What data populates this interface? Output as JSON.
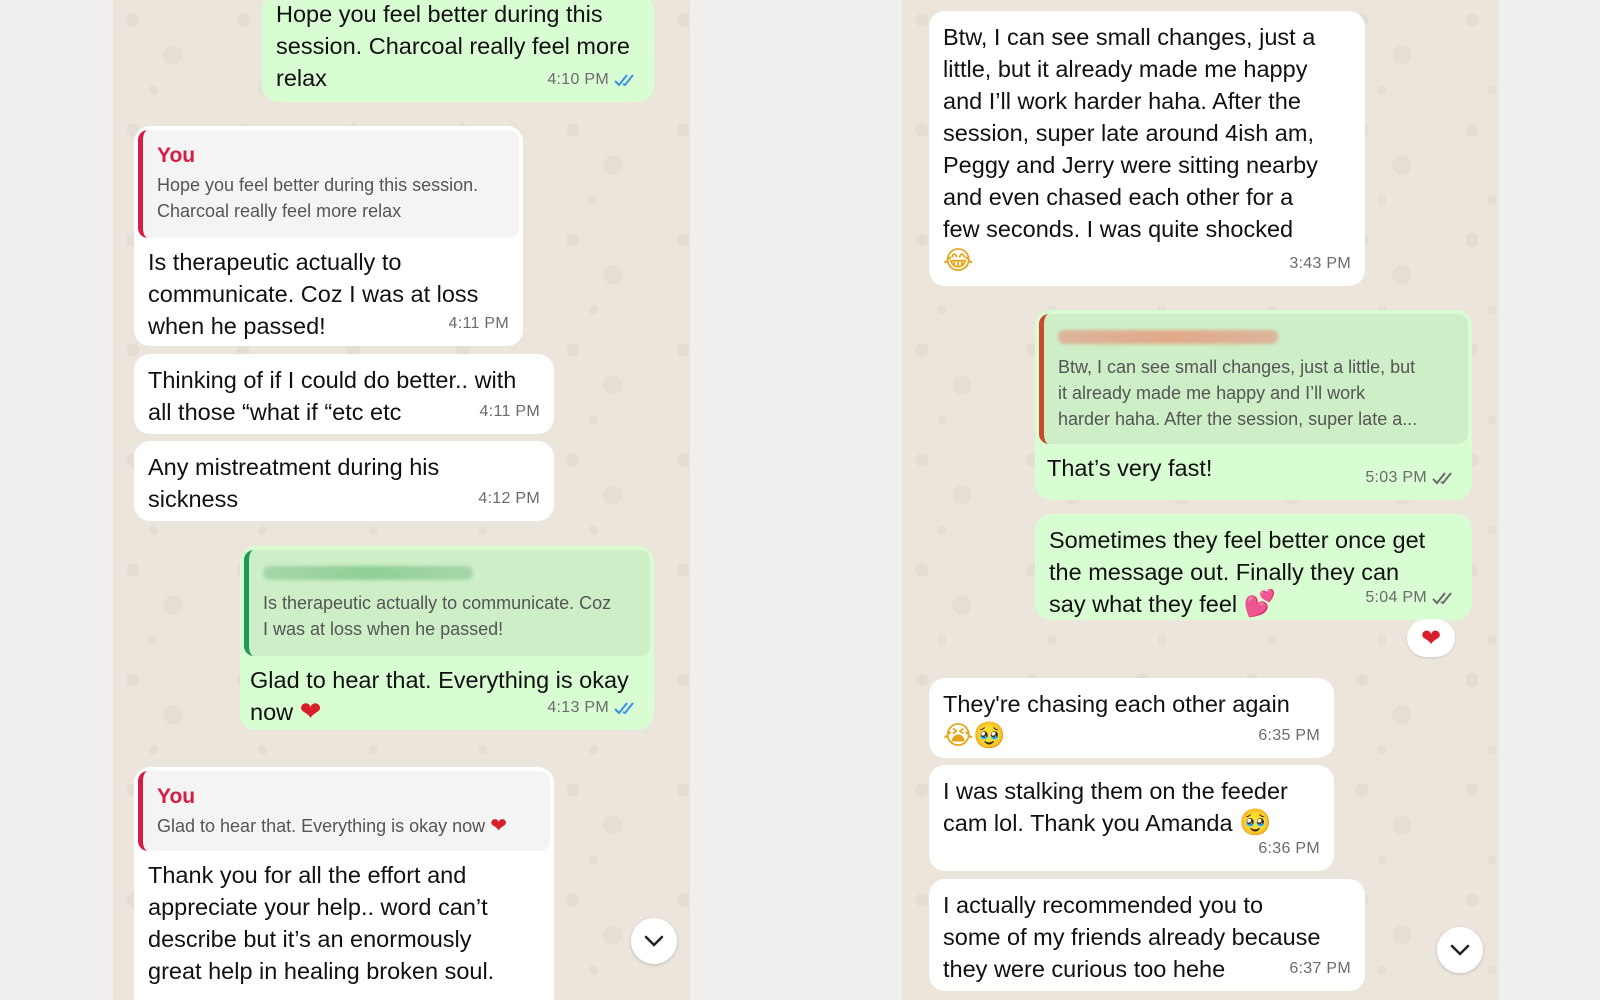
{
  "left_chat": {
    "messages": [
      {
        "text": "Hope you feel better during this\nsession. Charcoal really feel more\nrelax",
        "time": "4:10 PM"
      },
      {
        "quote_author": "You",
        "quote_text": "Hope you feel better during this session.\nCharcoal really feel more relax",
        "text": "Is therapeutic actually to\ncommunicate. Coz I was at loss\nwhen he passed!",
        "time": "4:11 PM"
      },
      {
        "text": "Thinking of if I could do better.. with\nall those “what if “etc etc",
        "time": "4:11 PM"
      },
      {
        "text": "Any mistreatment during his\nsickness",
        "time": "4:12 PM"
      },
      {
        "quote_text": "Is therapeutic actually to communicate. Coz\nI was at loss when he passed!",
        "text": "Glad to hear that. Everything is okay\nnow",
        "time": "4:13 PM"
      },
      {
        "quote_author": "You",
        "quote_text": "Glad to hear that. Everything is okay now",
        "text": "Thank you for all the effort and\nappreciate your help.. word can’t\ndescribe but it’s an enormously\ngreat help in healing broken soul."
      }
    ]
  },
  "right_chat": {
    "messages": [
      {
        "text": "Btw, I can see small changes, just a\nlittle, but it already made me happy\nand I’ll work harder haha. After the\nsession, super late around 4ish am,\nPeggy and Jerry were sitting nearby\nand even chased each other for a\nfew seconds. I was quite shocked",
        "time": "3:43 PM"
      },
      {
        "quote_text": "Btw, I can see small changes, just a little, but\nit already made me happy and I’ll work\nharder haha. After the session, super late a...",
        "text": "That’s very fast!",
        "time": "5:03 PM"
      },
      {
        "text": "Sometimes they feel better once get\nthe message out. Finally they can\nsay what they feel",
        "time": "5:04 PM",
        "reaction": "❤"
      },
      {
        "text": "They're chasing each other again",
        "time": "6:35 PM"
      },
      {
        "text": "I was stalking them on the feeder\ncam lol. Thank you Amanda",
        "time": "6:36 PM"
      },
      {
        "text": "I actually recommended you to\nsome of my friends already because\nthey were curious too hehe",
        "time": "6:37 PM"
      }
    ]
  },
  "icons": {
    "read_receipt_blue": "#3b8fe8",
    "read_receipt_grey": "#6b6b6b",
    "scroll_down": "chevron-down-icon"
  }
}
